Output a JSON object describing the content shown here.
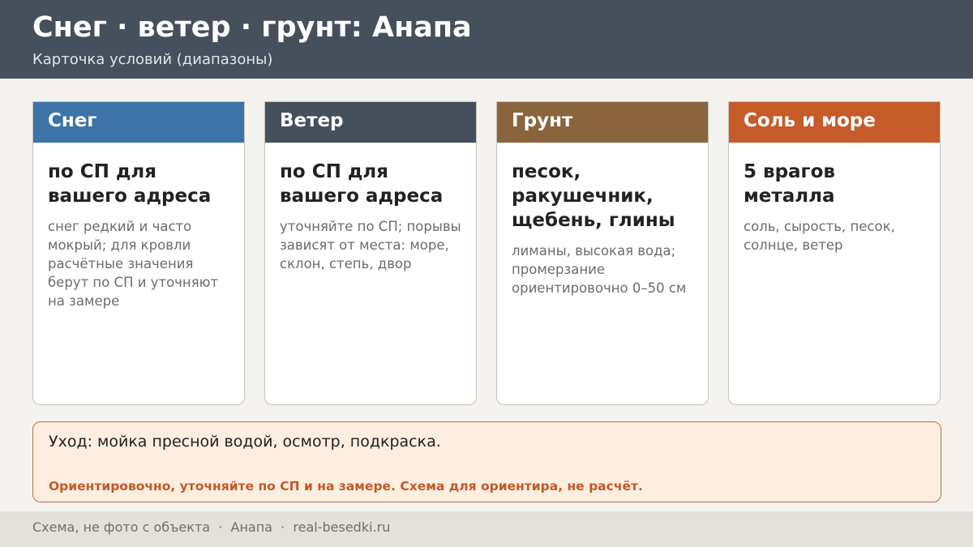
{
  "header": {
    "title": "Снег · ветер · грунт: Анапа",
    "subtitle": "Карточка условий (диапазоны)"
  },
  "cards": [
    {
      "label": "Снег",
      "color": "#3c73a8",
      "value": "по СП для вашего адреса",
      "note": "снег редкий и часто мокрый; для кровли расчётные значения берут по СП и уточняют на замере"
    },
    {
      "label": "Ветер",
      "color": "#46505c",
      "value": "по СП для вашего адреса",
      "note": "уточняйте по СП; порывы зависят от места: море, склон, степь, двор"
    },
    {
      "label": "Грунт",
      "color": "#8a643c",
      "value": "песок, ракушечник, щебень, глины",
      "note": "лиманы, высокая вода; промерзание ориентировочно 0–50 см"
    },
    {
      "label": "Соль и море",
      "color": "#c55b28",
      "value": "5 врагов металла",
      "note": "соль, сырость, песок, солнце, ветер"
    }
  ],
  "note_box": {
    "care": "Уход: мойка пресной водой, осмотр, подкраска.",
    "warning": "Ориентировочно, уточняйте по СП и на замере. Схема для ориентира, не расчёт."
  },
  "footer": {
    "text": "Схема, не фото с объекта  ·  Анапа  ·  real-besedki.ru"
  }
}
